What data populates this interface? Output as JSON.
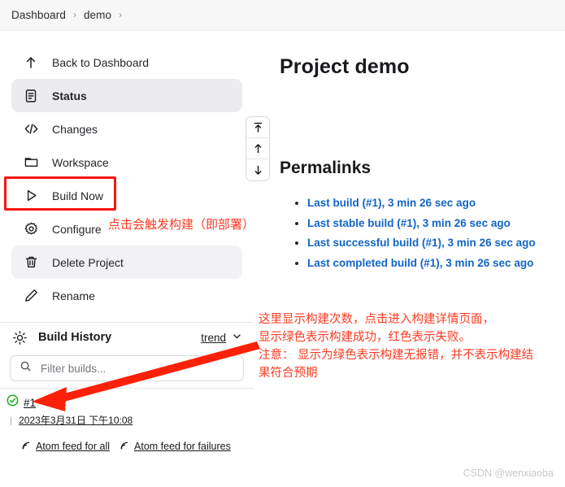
{
  "breadcrumb": {
    "items": [
      {
        "label": "Dashboard"
      },
      {
        "label": "demo"
      }
    ],
    "separator": "›"
  },
  "sidebar": {
    "items": [
      {
        "label": "Back to Dashboard",
        "icon": "arrow-up-icon",
        "state": "normal"
      },
      {
        "label": "Status",
        "icon": "document-icon",
        "state": "active"
      },
      {
        "label": "Changes",
        "icon": "code-icon",
        "state": "normal"
      },
      {
        "label": "Workspace",
        "icon": "folder-icon",
        "state": "normal"
      },
      {
        "label": "Build Now",
        "icon": "play-icon",
        "state": "boxed"
      },
      {
        "label": "Configure",
        "icon": "gear-icon",
        "state": "normal"
      },
      {
        "label": "Delete Project",
        "icon": "trash-icon",
        "state": "hover"
      },
      {
        "label": "Rename",
        "icon": "pencil-icon",
        "state": "normal"
      }
    ]
  },
  "build_history": {
    "title": "Build History",
    "icon": "sun-icon",
    "trend_label": "trend",
    "filter": {
      "placeholder": "Filter builds...",
      "value": "",
      "icon": "search-icon"
    },
    "builds": [
      {
        "number": "#1",
        "status": "success",
        "status_icon": "check-circle-icon",
        "date": "2023年3月31日 下午10:08"
      }
    ],
    "feeds": [
      {
        "label": "Atom feed for all",
        "icon": "rss-icon"
      },
      {
        "label": "Atom feed for failures",
        "icon": "rss-icon"
      }
    ],
    "scroll_buttons": [
      {
        "name": "scroll-to-top",
        "icon": "arrow-up-bar-icon"
      },
      {
        "name": "scroll-up",
        "icon": "arrow-up-icon"
      },
      {
        "name": "scroll-down",
        "icon": "arrow-down-icon"
      }
    ]
  },
  "main": {
    "page_title": "Project demo",
    "permalinks_heading": "Permalinks",
    "permalinks": [
      {
        "label": "Last build (#1), 3 min 26 sec ago"
      },
      {
        "label": "Last stable build (#1), 3 min 26 sec ago"
      },
      {
        "label": "Last successful build (#1), 3 min 26 sec ago"
      },
      {
        "label": "Last completed build (#1), 3 min 26 sec ago"
      }
    ]
  },
  "annotations": {
    "build_now": "点击会触发构建（即部署）",
    "build_history_line1": "这里显示构建次数，点击进入构建详情页面，",
    "build_history_line2": "显示绿色表示构建成功，红色表示失败。",
    "build_history_line3": "注意： 显示为绿色表示构建无报错，并不表示构建结",
    "build_history_line4": "果符合预期"
  },
  "watermark": "CSDN @wenxiaoba",
  "colors": {
    "annotation_red": "#fc3b22",
    "box_red": "#fb1414",
    "link_blue": "#1265c8",
    "success_green": "#17a81a",
    "breadcrumb_bg": "#f7f7f8"
  }
}
